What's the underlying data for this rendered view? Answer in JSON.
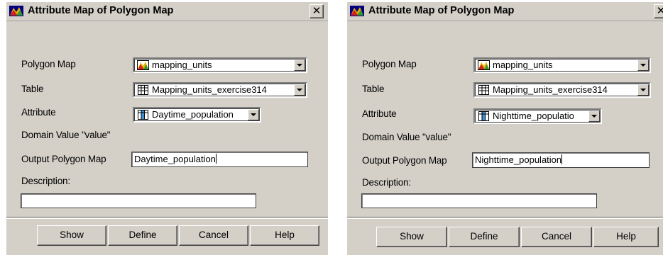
{
  "dialogs": [
    {
      "title": "Attribute Map of Polygon Map",
      "close_label": "✕",
      "labels": {
        "polygon_map": "Polygon Map",
        "table": "Table",
        "attribute": "Attribute",
        "domain": "Domain Value \"value\"",
        "output": "Output Polygon Map",
        "description": "Description:"
      },
      "polygon_map_value": "mapping_units",
      "table_value": "Mapping_units_exercise314",
      "attribute_value": "Daytime_population",
      "output_value": "Daytime_population",
      "description_value": "",
      "buttons": {
        "show": "Show",
        "define": "Define",
        "cancel": "Cancel",
        "help": "Help"
      }
    },
    {
      "title": "Attribute Map of Polygon Map",
      "close_label": "✕",
      "labels": {
        "polygon_map": "Polygon Map",
        "table": "Table",
        "attribute": "Attribute",
        "domain": "Domain Value \"value\"",
        "output": "Output Polygon Map",
        "description": "Description:"
      },
      "polygon_map_value": "mapping_units",
      "table_value": "Mapping_units_exercise314",
      "attribute_value": "Nighttime_populatio",
      "output_value": "Nighttime_population",
      "description_value": "",
      "buttons": {
        "show": "Show",
        "define": "Define",
        "cancel": "Cancel",
        "help": "Help"
      }
    }
  ],
  "icons": {
    "title": "polygon-map-app-icon",
    "polygon_map": "polygon-map-icon",
    "table": "table-icon",
    "attribute": "column-icon",
    "dropdown": "chevron-down-icon"
  }
}
